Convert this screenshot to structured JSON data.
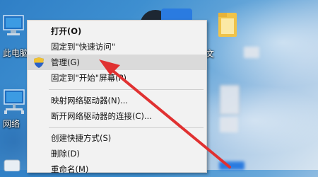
{
  "desktop": {
    "icons": [
      {
        "label": "此电脑",
        "icon": "computer-icon"
      },
      {
        "label": "网络",
        "icon": "network-icon"
      }
    ],
    "partial_label": "文"
  },
  "context_menu": {
    "items": [
      {
        "label": "打开(O)",
        "bold": true
      },
      {
        "label": "固定到\"快速访问\""
      },
      {
        "label": "管理(G)",
        "highlighted": true,
        "icon": "shield-icon"
      },
      {
        "label": "固定到\"开始\"屏幕(P)"
      },
      {
        "label": "映射网络驱动器(N)..."
      },
      {
        "label": "断开网络驱动器的连接(C)..."
      },
      {
        "label": "创建快捷方式(S)"
      },
      {
        "label": "删除(D)"
      },
      {
        "label": "重命名(M)"
      }
    ]
  },
  "annotation": {
    "type": "arrow",
    "color": "#e03131",
    "points_to": "管理(G)"
  }
}
